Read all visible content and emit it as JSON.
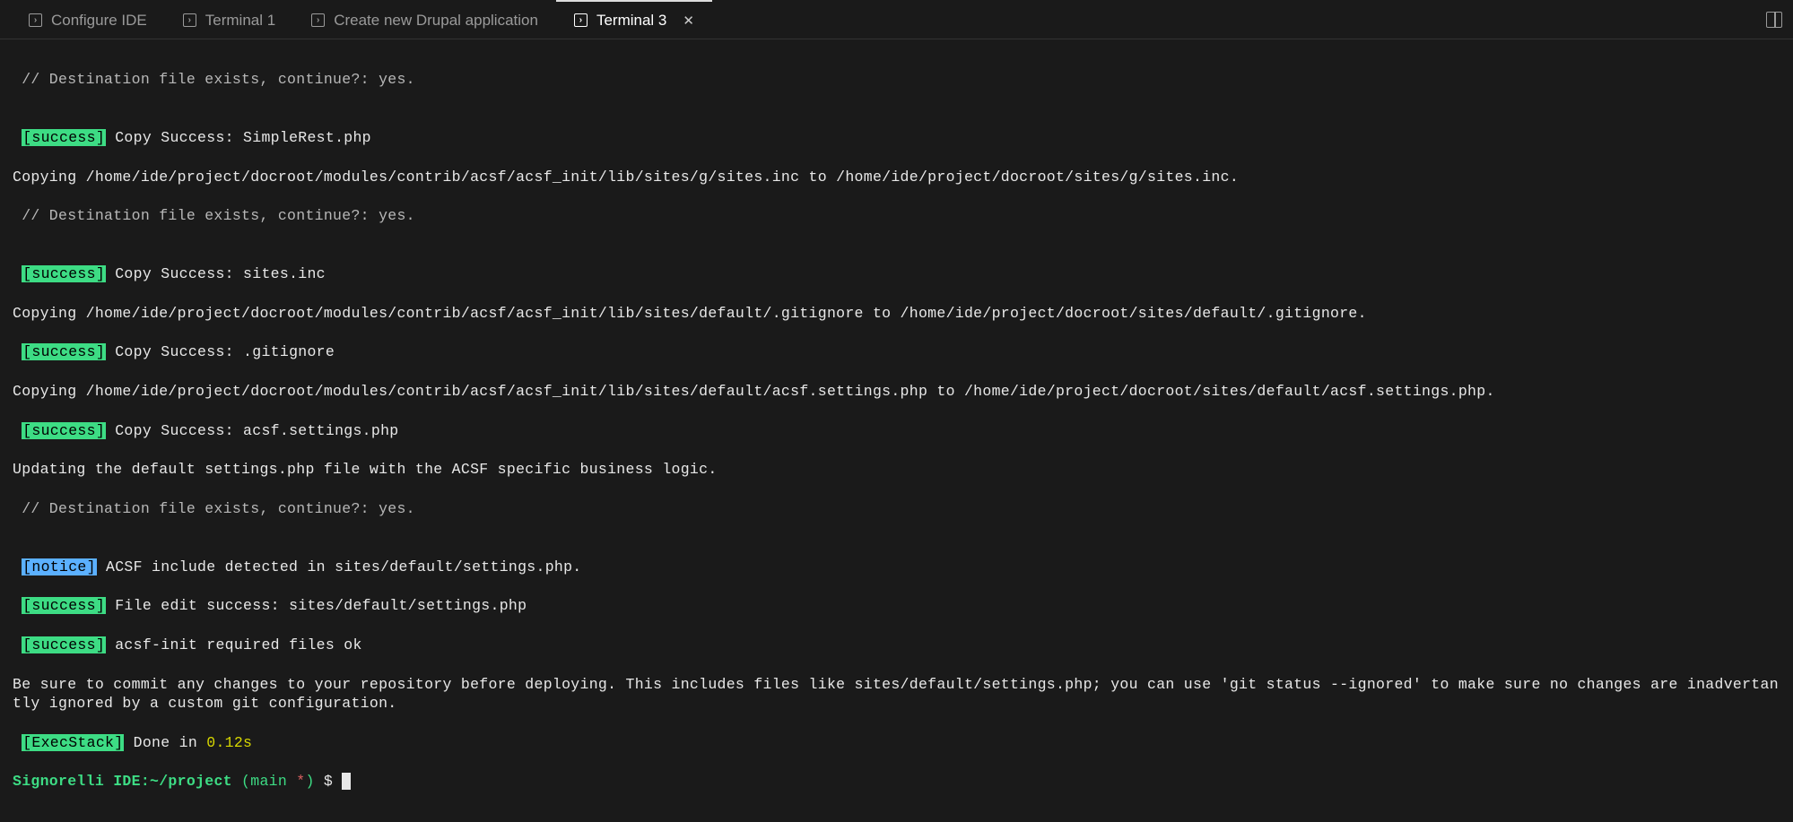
{
  "tabs": [
    {
      "label": "Configure IDE",
      "active": false
    },
    {
      "label": "Terminal 1",
      "active": false
    },
    {
      "label": "Create new Drupal application",
      "active": false
    },
    {
      "label": "Terminal 3",
      "active": true
    }
  ],
  "terminal": {
    "l01": " // Destination file exists, continue?: yes.",
    "blank1": "",
    "s1_badge": "[success]",
    "s1_msg": " Copy Success: SimpleRest.php",
    "l02": "Copying /home/ide/project/docroot/modules/contrib/acsf/acsf_init/lib/sites/g/sites.inc to /home/ide/project/docroot/sites/g/sites.inc.",
    "l03": " // Destination file exists, continue?: yes.",
    "blank2": "",
    "s2_badge": "[success]",
    "s2_msg": " Copy Success: sites.inc",
    "l04": "Copying /home/ide/project/docroot/modules/contrib/acsf/acsf_init/lib/sites/default/.gitignore to /home/ide/project/docroot/sites/default/.gitignore.",
    "s3_badge": "[success]",
    "s3_msg": " Copy Success: .gitignore",
    "l05": "Copying /home/ide/project/docroot/modules/contrib/acsf/acsf_init/lib/sites/default/acsf.settings.php to /home/ide/project/docroot/sites/default/acsf.settings.php.",
    "s4_badge": "[success]",
    "s4_msg": " Copy Success: acsf.settings.php",
    "l06": "Updating the default settings.php file with the ACSF specific business logic.",
    "l07": " // Destination file exists, continue?: yes.",
    "blank3": "",
    "n1_badge": "[notice]",
    "n1_msg": " ACSF include detected in sites/default/settings.php.",
    "s5_badge": "[success]",
    "s5_msg": " File edit success: sites/default/settings.php",
    "s6_badge": "[success]",
    "s6_msg": " acsf-init required files ok",
    "advice": "Be sure to commit any changes to your repository before deploying. This includes files like sites/default/settings.php; you can use 'git status --ignored' to make sure no changes are inadvertantly ignored by a custom git configuration.",
    "exec_badge": "[ExecStack]",
    "exec_done": " Done in ",
    "exec_time": "0.12s",
    "prompt_host": "Signorelli IDE:",
    "prompt_path": "~/project",
    "prompt_branch_open": " (",
    "prompt_branch": "main ",
    "prompt_asterisk": "*",
    "prompt_branch_close": ")",
    "prompt_dollar": " $ "
  }
}
